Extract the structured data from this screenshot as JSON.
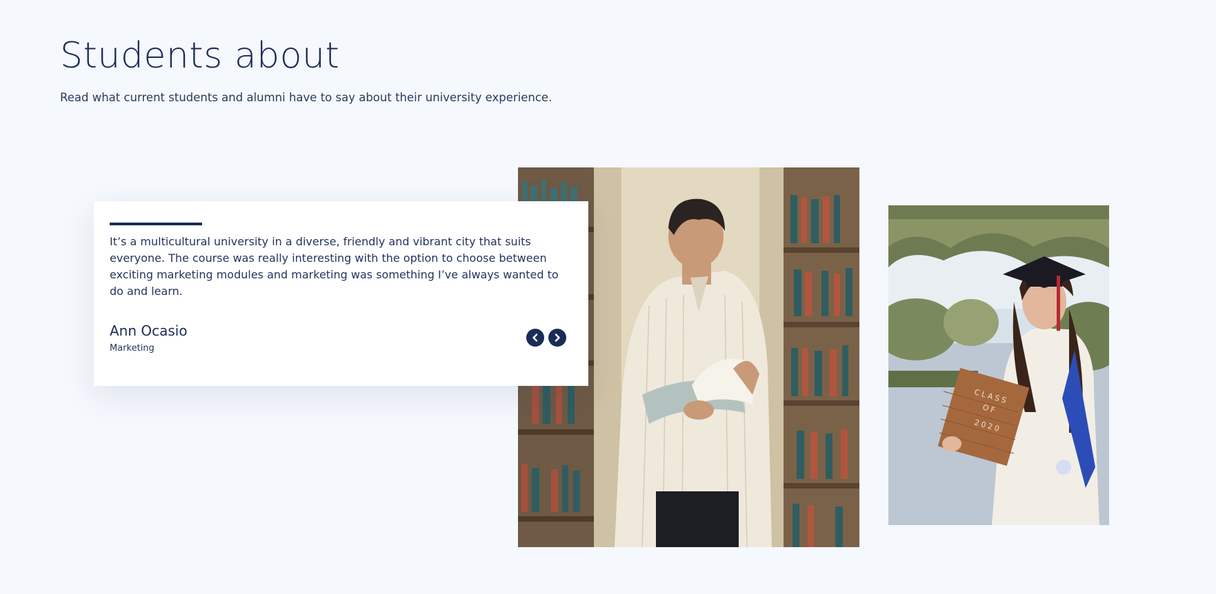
{
  "header": {
    "title": "Students about",
    "subtitle": "Read what current students and alumni have to say about their university experience."
  },
  "testimonial": {
    "quote": "It’s a multicultural university in a diverse, friendly and vibrant city that suits everyone. The course was really interesting with the option to choose between exciting marketing modules and marketing was something I’ve always wanted to do and learn.",
    "author_name": "Ann Ocasio",
    "author_program": "Marketing"
  },
  "photos": {
    "side_board_lines": [
      "CLASS",
      "OF",
      "2020"
    ]
  },
  "navigation": {
    "prev_icon": "chevron-left-icon",
    "next_icon": "chevron-right-icon"
  },
  "colors": {
    "background": "#f5f8fd",
    "navy": "#1b2b57",
    "card": "#ffffff"
  }
}
